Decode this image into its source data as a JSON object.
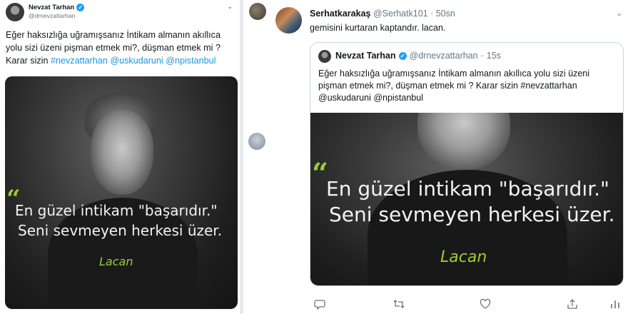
{
  "left_tweet": {
    "name": "Nevzat Tarhan",
    "handle": "@drnevzattarhan",
    "text_lines": [
      [
        "Eğer haksızlığa uğramışsanız İntikam almanın akıllıca"
      ],
      [
        "yolu sizi üzeni pişman etmek mi?, düşman etmek mi ?"
      ],
      [
        "Karar sizin ",
        "#nevzattarhan @uskudaruni @npistanbul"
      ]
    ],
    "image": {
      "quote_mark": "“",
      "quote_line1": "En güzel intikam \"başarıdır.\"",
      "quote_line2": "Seni sevmeyen herkesi üzer.",
      "author": "Lacan"
    }
  },
  "right_tweet": {
    "name": "Serhatkarakaş",
    "handle": "@Serhatk101",
    "separator": "·",
    "time": "50sn",
    "text": "gemisini kurtaran kaptandır.  lacan.",
    "quoted": {
      "name": "Nevzat Tarhan",
      "handle": "@drnevzattarhan",
      "separator": "·",
      "time": "15s",
      "text_lines": [
        "Eğer haksızlığa uğramışsanız İntikam almanın akıllıca yolu sizi üzeni",
        "pişman etmek mi?, düşman etmek mi ? Karar sizin #nevzattarhan",
        "@uskudaruni @npistanbul"
      ],
      "image": {
        "quote_mark": "“",
        "quote_line1": "En güzel intikam \"başarıdır.\"",
        "quote_line2": "Seni sevmeyen herkesi üzer.",
        "author": "Lacan"
      }
    },
    "actions": [
      "reply-icon",
      "retweet-icon",
      "like-icon",
      "share-icon",
      "analytics-icon"
    ]
  },
  "colors": {
    "link": "#1b95e0",
    "verified": "#1da1f2",
    "quote_accent": "#9acd32",
    "muted": "#657786"
  }
}
